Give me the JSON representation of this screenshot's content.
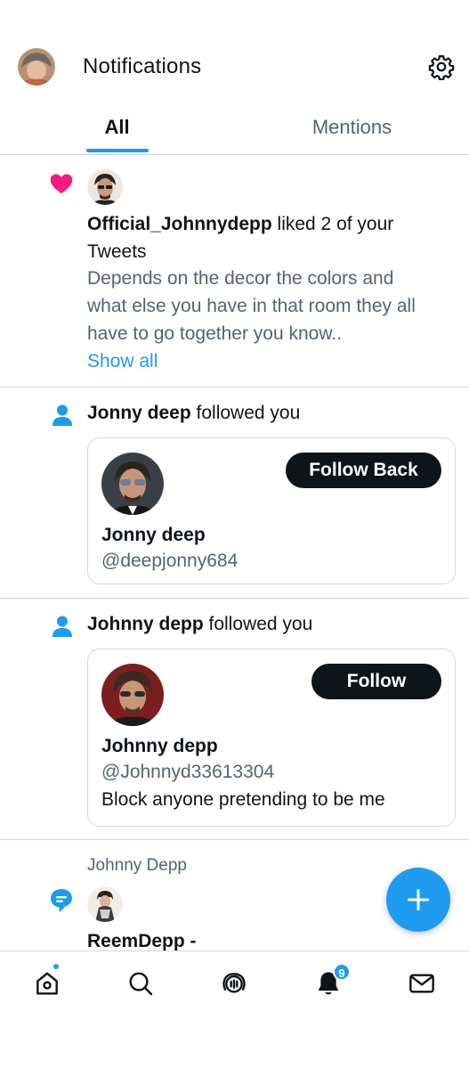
{
  "header": {
    "title": "Notifications",
    "avatar_icon": "user-avatar",
    "settings_icon": "gear-icon"
  },
  "tabs": [
    {
      "label": "All",
      "active": true
    },
    {
      "label": "Mentions",
      "active": false
    }
  ],
  "notifications": [
    {
      "type": "like",
      "icon": "heart-icon",
      "user": "Official_Johnnydepp",
      "action": " liked 2 of your",
      "action_cont": "Tweets",
      "preview_lines": [
        "Depends on the decor the colors and",
        "what else you have in that room they all",
        "have to go together you know.."
      ],
      "show_all": "Show all"
    },
    {
      "type": "follow",
      "icon": "person-icon",
      "user": "Jonny deep",
      "action": " followed you",
      "card": {
        "name": "Jonny deep",
        "handle": "@deepjonny684",
        "button": "Follow Back"
      }
    },
    {
      "type": "follow",
      "icon": "person-icon",
      "user": "Johnny depp",
      "action": " followed you",
      "card": {
        "name": "Johnny depp",
        "handle": "@Johnnyd33613304",
        "bio": "Block anyone pretending to be me",
        "button": "Follow"
      }
    },
    {
      "type": "reply",
      "icon": "speech-bubble-icon",
      "context": "Johnny Depp",
      "user": "ReemDepp -"
    }
  ],
  "fab": {
    "icon": "plus-icon"
  },
  "bottom_nav": [
    {
      "icon": "home-icon"
    },
    {
      "icon": "search-icon"
    },
    {
      "icon": "spaces-icon"
    },
    {
      "icon": "bell-icon",
      "badge": "9"
    },
    {
      "icon": "mail-icon"
    }
  ],
  "colors": {
    "accent": "#1d9bf0",
    "heart": "#f91880",
    "text": "#0f1419",
    "muted": "#536471",
    "border": "#cfd9de"
  }
}
